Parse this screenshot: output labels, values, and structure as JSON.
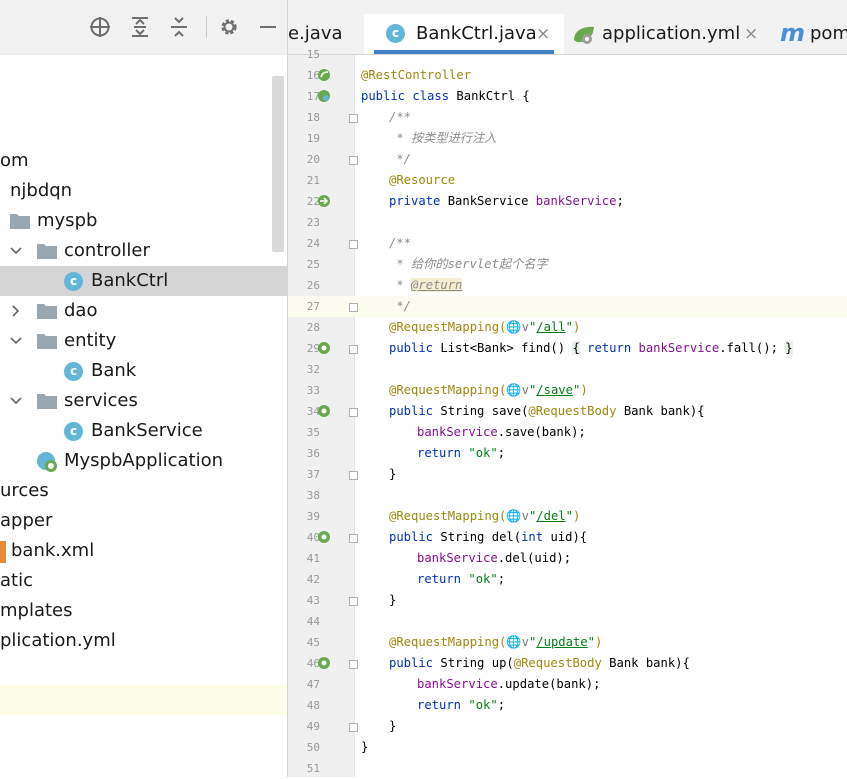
{
  "project_tree": {
    "items": [
      {
        "label": "om"
      },
      {
        "label": "njbdqn"
      },
      {
        "label": "myspb"
      },
      {
        "label": "controller"
      },
      {
        "label": "BankCtrl"
      },
      {
        "label": "dao"
      },
      {
        "label": "entity"
      },
      {
        "label": "Bank"
      },
      {
        "label": "services"
      },
      {
        "label": "BankService"
      },
      {
        "label": "MyspbApplication"
      },
      {
        "label": "urces"
      },
      {
        "label": "apper"
      },
      {
        "label": "bank.xml"
      },
      {
        "label": "atic"
      },
      {
        "label": "mplates"
      },
      {
        "label": "plication.yml"
      }
    ]
  },
  "tabs": [
    {
      "label": "e.java"
    },
    {
      "label": "BankCtrl.java",
      "active": true
    },
    {
      "label": "application.yml"
    },
    {
      "label": "pom"
    }
  ],
  "tab_close_glyph": "×",
  "class_icon_letter": "c",
  "module_icon_letter": "m",
  "editor": {
    "line_numbers": [
      "15",
      "16",
      "17",
      "18",
      "19",
      "20",
      "21",
      "22",
      "23",
      "24",
      "25",
      "26",
      "27",
      "28",
      "29",
      "32",
      "33",
      "34",
      "35",
      "36",
      "37",
      "38",
      "39",
      "40",
      "41",
      "42",
      "43",
      "44",
      "45",
      "46",
      "47",
      "48",
      "49",
      "50",
      "51"
    ],
    "code": {
      "l16": "@RestController",
      "l17a": "public class",
      "l17b": " BankCtrl {",
      "l18": "/**",
      "l19": " * 按类型进行注入",
      "l20": " */",
      "l21": "@Resource",
      "l22a": "private",
      "l22b": " BankService ",
      "l22c": "bankService",
      "l22d": ";",
      "l24": "/**",
      "l25": " * 给你的servlet起个名字",
      "l26a": " * ",
      "l26b": "@return",
      "l27": " */",
      "l28a": "@RequestMapping(",
      "l28g": "🌐",
      "l28v": "v",
      "l28b": "\"",
      "l28c": "/all",
      "l28d": "\"",
      "l28e": ")",
      "l29a": "public",
      "l29b": " List<Bank> find() ",
      "l29c": "{",
      "l29d": " return ",
      "l29e": "bankService",
      "l29f": ".fall(); ",
      "l29g": "}",
      "l33a": "@RequestMapping(",
      "l33g": "🌐",
      "l33v": "v",
      "l33b": "\"",
      "l33c": "/save",
      "l33d": "\"",
      "l33e": ")",
      "l34a": "public",
      "l34b": " String save(",
      "l34c": "@RequestBody",
      "l34d": " Bank bank){",
      "l35a": "bankService",
      "l35b": ".save(bank);",
      "l36a": "return",
      "l36b": " \"ok\"",
      "l36c": ";",
      "l37": "}",
      "l39a": "@RequestMapping(",
      "l39g": "🌐",
      "l39v": "v",
      "l39b": "\"",
      "l39c": "/del",
      "l39d": "\"",
      "l39e": ")",
      "l40a": "public",
      "l40b": " String del(",
      "l40c": "int",
      "l40d": " uid){",
      "l41a": "bankService",
      "l41b": ".del(uid);",
      "l42a": "return",
      "l42b": " \"ok\"",
      "l42c": ";",
      "l43": "}",
      "l45a": "@RequestMapping(",
      "l45g": "🌐",
      "l45v": "v",
      "l45b": "\"",
      "l45c": "/update",
      "l45d": "\"",
      "l45e": ")",
      "l46a": "public",
      "l46b": " String up(",
      "l46c": "@RequestBody",
      "l46d": " Bank bank){",
      "l47a": "bankService",
      "l47b": ".update(bank);",
      "l48a": "return",
      "l48b": " \"ok\"",
      "l48c": ";",
      "l49": "}",
      "l50": "}"
    }
  },
  "colors": {
    "keyword": "#0033b3",
    "annotation": "#9e880d",
    "field": "#871094",
    "comment": "#8c8c8c",
    "string": "#067d17",
    "selection": "#d5d5d5",
    "accent": "#4083c9"
  }
}
